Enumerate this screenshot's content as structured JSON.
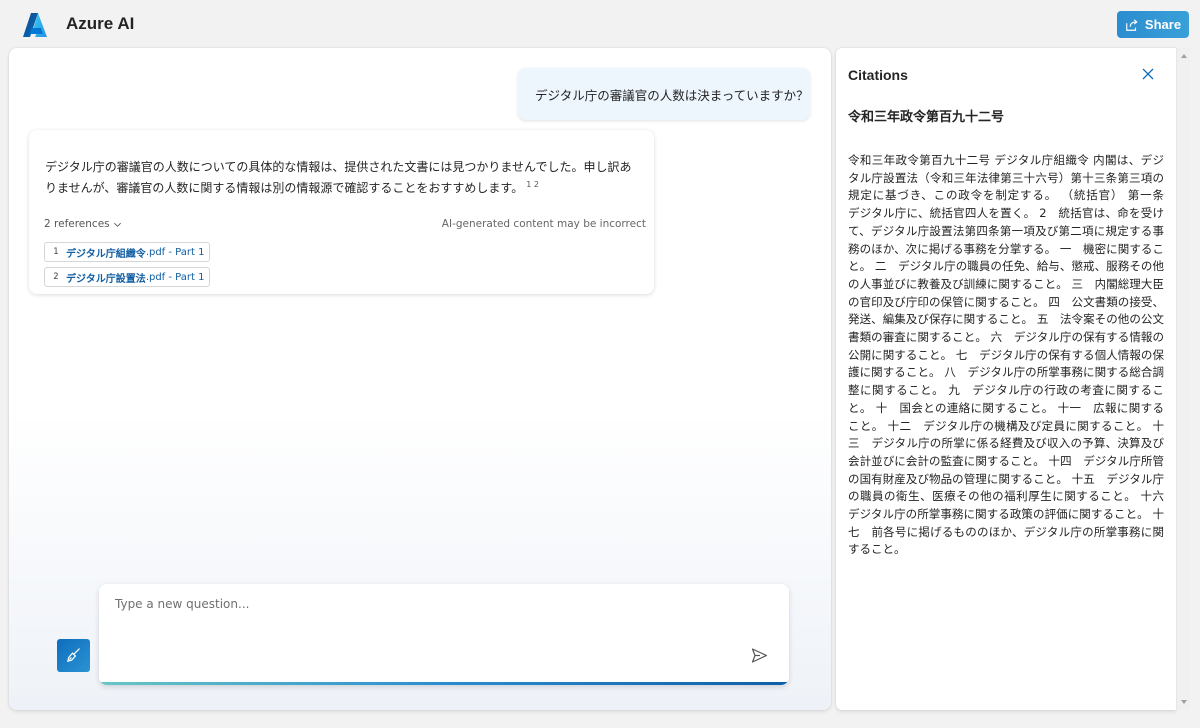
{
  "app": {
    "title": "Azure AI",
    "share_label": "Share",
    "brand_color": "#0f6cbd"
  },
  "chat": {
    "user_message": "デジタル庁の審議官の人数は決まっていますか？",
    "answer": {
      "text": "デジタル庁の審議官の人数についての具体的な情報は、提供された文書には見つかりませんでした。申し訳ありませんが、審議官の人数に関する情報は別の情報源で確認することをおすすめします。",
      "superscripts": "1 2",
      "references_toggle": "2 references",
      "disclaimer": "AI-generated content may be incorrect",
      "references": [
        {
          "num": "1",
          "name": "デジタル庁組織令",
          "suffix": ".pdf - Part 1"
        },
        {
          "num": "2",
          "name": "デジタル庁設置法",
          "suffix": ".pdf - Part 1"
        }
      ]
    },
    "input": {
      "placeholder": "Type a new question...",
      "value": ""
    },
    "icons": {
      "clear": "broom-icon",
      "send": "send-icon"
    }
  },
  "citations": {
    "heading": "Citations",
    "title": "令和三年政令第百九十二号",
    "body": "令和三年政令第百九十二号 デジタル庁組織令 内閣は、デジタル庁設置法（令和三年法律第三十六号）第十三条第三項の規定に基づき、この政令を制定する。 （統括官） 第一条　デジタル庁に、統括官四人を置く。 2　統括官は、命を受けて、デジタル庁設置法第四条第一項及び第二項に規定する事務のほか、次に掲げる事務を分掌する。 一　機密に関すること。 二　デジタル庁の職員の任免、給与、懲戒、服務その他の人事並びに教養及び訓練に関すること。 三　内閣総理大臣の官印及び庁印の保管に関すること。 四　公文書類の接受、発送、編集及び保存に関すること。 五　法令案その他の公文書類の審査に関すること。 六　デジタル庁の保有する情報の公開に関すること。 七　デジタル庁の保有する個人情報の保護に関すること。 八　デジタル庁の所掌事務に関する総合調整に関すること。 九　デジタル庁の行政の考査に関すること。 十　国会との連絡に関すること。 十一　広報に関すること。 十二　デジタル庁の機構及び定員に関すること。 十三　デジタル庁の所掌に係る経費及び収入の予算、決算及び会計並びに会計の監査に関すること。 十四　デジタル庁所管の国有財産及び物品の管理に関すること。 十五　デジタル庁の職員の衛生、医療その他の福利厚生に関すること。 十六　デジタル庁の所掌事務に関する政策の評価に関すること。 十七　前各号に掲げるもののほか、デジタル庁の所掌事務に関すること。"
  }
}
